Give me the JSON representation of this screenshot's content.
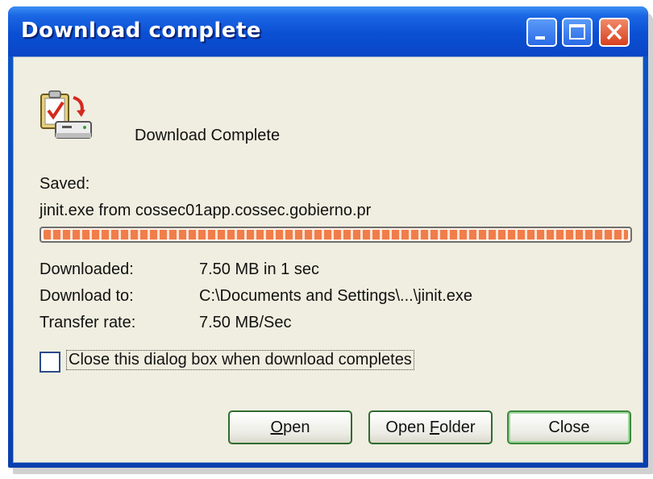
{
  "window": {
    "title": "Download complete"
  },
  "content": {
    "heading": "Download Complete",
    "saved_label": "Saved:",
    "saved_file": "jinit.exe from cossec01app.cossec.gobierno.pr",
    "progress": 1.0,
    "details": [
      {
        "label": "Downloaded:",
        "value": "7.50 MB in 1 sec"
      },
      {
        "label": "Download to:",
        "value": "C:\\Documents and Settings\\...\\jinit.exe"
      },
      {
        "label": "Transfer rate:",
        "value": "7.50 MB/Sec"
      }
    ],
    "close_checkbox": {
      "label": "Close this dialog box when download completes",
      "checked": false
    }
  },
  "buttons": {
    "open": {
      "pre": "",
      "key": "O",
      "post": "pen"
    },
    "open_folder": {
      "pre": "Open ",
      "key": "F",
      "post": "older"
    },
    "close": "Close"
  },
  "icons": {
    "dialog_icon": "download-complete-icon",
    "minimize": "minimize-icon",
    "maximize": "maximize-icon",
    "close": "close-icon"
  },
  "colors": {
    "titlebar": "#0a4fd3",
    "client_bg": "#efeee0",
    "progress_fill": "#f07d4a",
    "close_button": "#d8401f"
  }
}
